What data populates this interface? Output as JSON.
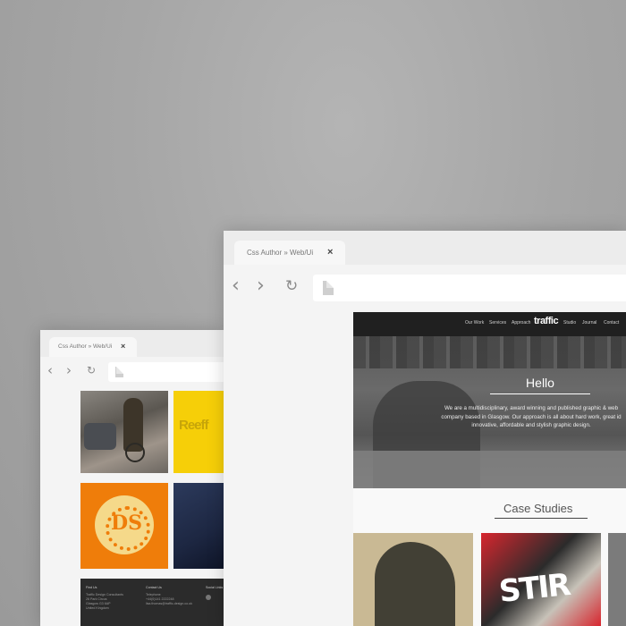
{
  "background_color": "#a6a6a6",
  "browser_back": {
    "tab_title": "Css Author » Web/Ui",
    "tab_close": "×",
    "nav": {
      "back_icon": "chevron-left-icon",
      "forward_icon": "chevron-right-icon",
      "reload_icon": "reload-icon"
    },
    "nav_glyphs": {
      "back": "‹",
      "forward": "›",
      "reload": "↻"
    },
    "address_icon": "document-icon",
    "portfolio": {
      "tiles": [
        {
          "name": "cyclist-photo"
        },
        {
          "name": "yellow-poster",
          "text": "Reeff"
        },
        {
          "name": "orange-badge",
          "text": "DS"
        },
        {
          "name": "navy-print"
        }
      ],
      "footer": {
        "col1": {
          "heading": "Find Us",
          "lines": [
            "Traffic Design Consultants",
            "26 Park Circus",
            "Glasgow G3 6AP",
            "United Kingdom"
          ]
        },
        "col2": {
          "heading": "Contact Us",
          "lines": [
            "Telephone",
            "+44(0)141 2222248",
            "lisa.thomas@traffic-design.co.uk"
          ]
        },
        "col3": {
          "heading": "Social Links"
        }
      }
    }
  },
  "browser_front": {
    "tab_title": "Css Author » Web/Ui",
    "tab_close": "×",
    "nav_glyphs": {
      "back": "‹",
      "forward": "›",
      "reload": "↻"
    },
    "address_icon": "document-icon",
    "site": {
      "nav_left": [
        "Our Work",
        "Services",
        "Approach"
      ],
      "logo": "traffic",
      "nav_right": [
        "Studio",
        "Journal",
        "Contact"
      ],
      "hero": {
        "heading": "Hello",
        "lines": [
          "We are a multidisciplinary, award winning and published graphic & web",
          "company based in Glasgow. Our approach is all about hard work, great id",
          "innovative, affordable and stylish graphic design."
        ]
      },
      "case_studies": {
        "heading": "Case Studies",
        "cards": [
          {
            "name": "figure-illustration"
          },
          {
            "name": "stir-magazine",
            "text": "STIR"
          },
          {
            "name": "grey-card"
          }
        ]
      }
    }
  }
}
